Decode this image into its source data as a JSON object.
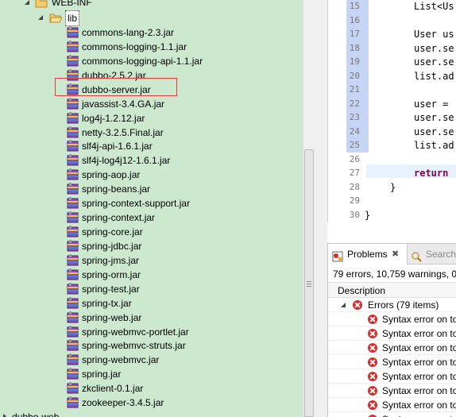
{
  "explorer": {
    "web_inf_label": "WEB-INF",
    "lib_label": "lib",
    "jars": [
      "commons-lang-2.3.jar",
      "commons-logging-1.1.jar",
      "commons-logging-api-1.1.jar",
      "dubbo-2.5.2.jar",
      "dubbo-server.jar",
      "javassist-3.4.GA.jar",
      "log4j-1.2.12.jar",
      "netty-3.2.5.Final.jar",
      "slf4j-api-1.6.1.jar",
      "slf4j-log4j12-1.6.1.jar",
      "spring-aop.jar",
      "spring-beans.jar",
      "spring-context-support.jar",
      "spring-context.jar",
      "spring-core.jar",
      "spring-jdbc.jar",
      "spring-jms.jar",
      "spring-orm.jar",
      "spring-test.jar",
      "spring-tx.jar",
      "spring-web.jar",
      "spring-webmvc-portlet.jar",
      "spring-webmvc-struts.jar",
      "spring-webmvc.jar",
      "spring.jar",
      "zkclient-0.1.jar",
      "zookeeper-3.4.5.jar"
    ],
    "bottom_partial_label": "dubbo-web"
  },
  "editor": {
    "lines": [
      {
        "num": "15",
        "text": "List<Us"
      },
      {
        "num": "16",
        "text": ""
      },
      {
        "num": "17",
        "text": "User us"
      },
      {
        "num": "18",
        "text": "user.se"
      },
      {
        "num": "19",
        "text": "user.se"
      },
      {
        "num": "20",
        "text": "list.ad"
      },
      {
        "num": "21",
        "text": ""
      },
      {
        "num": "22",
        "text": "user = "
      },
      {
        "num": "23",
        "text": "user.se"
      },
      {
        "num": "24",
        "text": "user.se"
      },
      {
        "num": "25",
        "text": "list.ad"
      },
      {
        "num": "26",
        "text": ""
      },
      {
        "num": "27",
        "text": "return"
      },
      {
        "num": "28",
        "text": "}"
      },
      {
        "num": "29",
        "text": ""
      },
      {
        "num": "30",
        "text": "}"
      }
    ]
  },
  "problems": {
    "tab_label": "Problems",
    "tab_close": "✖",
    "search_tab_label": "Search",
    "summary": "79 errors, 10,759 warnings, 0 c",
    "column_description": "Description",
    "errors_group_label": "Errors (79 items)",
    "error_rows": [
      "Syntax error on to",
      "Syntax error on to",
      "Syntax error on to",
      "Syntax error on to",
      "Syntax error on to",
      "Syntax error on to",
      "Syntax error on to",
      "Syntax error on to"
    ]
  },
  "colors": {
    "explorer_bg": "#cce8cf",
    "highlight_box": "#e43b3b",
    "keyword": "#7f0055",
    "error_icon": "#d82c2c"
  }
}
